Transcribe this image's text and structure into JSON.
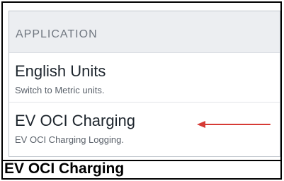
{
  "section": {
    "header": "APPLICATION"
  },
  "settings": [
    {
      "title": "English Units",
      "subtitle": "Switch to Metric units."
    },
    {
      "title": "EV OCI Charging",
      "subtitle": "EV OCI Charging Logging."
    }
  ],
  "annotation": {
    "arrow_color": "#d63a35"
  },
  "caption": {
    "text": "EV OCI Charging"
  }
}
